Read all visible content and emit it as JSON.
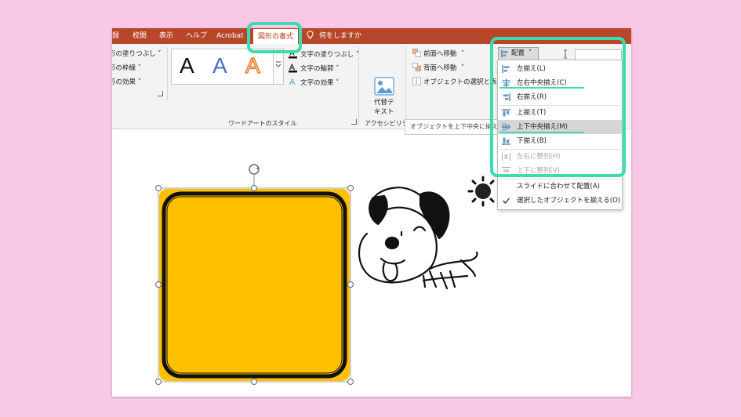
{
  "tabs": [
    {
      "label": "録"
    },
    {
      "label": "校閲"
    },
    {
      "label": "表示"
    },
    {
      "label": "ヘルプ"
    },
    {
      "label": "Acrobat"
    },
    {
      "label": "図形の書式",
      "active": true
    }
  ],
  "tell_me": "何をしますか",
  "ribbon": {
    "shape_fill": "形の塗りつぶし",
    "shape_outline": "形の枠線",
    "shape_effects": "形の効果",
    "wordart_letters": [
      "A",
      "A",
      "A"
    ],
    "text_fill": "文字の塗りつぶし",
    "text_outline": "文字の輪郭",
    "text_effects": "文字の効果",
    "wordart_group": "ワードアートのスタイル",
    "alt_text_line1": "代替テ",
    "alt_text_line2": "キスト",
    "accessibility_group": "アクセシビリティ",
    "bring_forward": "前面へ移動",
    "send_backward": "背面へ移動",
    "selection_pane": "オブジェクトの選択と表示",
    "arrange_group": "配置",
    "align_button": "配置"
  },
  "tooltip": "オブジェクトを上下中央に揃える",
  "align_menu": {
    "items": [
      {
        "label": "左揃え(L)",
        "icon": "align-left-icon",
        "enabled": true
      },
      {
        "label": "左右中央揃え(C)",
        "icon": "align-center-icon",
        "enabled": true
      },
      {
        "label": "右揃え(R)",
        "icon": "align-right-icon",
        "enabled": true
      },
      {
        "label": "上揃え(T)",
        "icon": "align-top-icon",
        "enabled": true
      },
      {
        "label": "上下中央揃え(M)",
        "icon": "align-middle-icon",
        "enabled": true,
        "hover": true
      },
      {
        "label": "下揃え(B)",
        "icon": "align-bottom-icon",
        "enabled": true
      },
      {
        "label": "左右に整列(H)",
        "icon": "distribute-horizontal-icon",
        "enabled": false
      },
      {
        "label": "上下に整列(V)",
        "icon": "distribute-vertical-icon",
        "enabled": false
      },
      {
        "label": "スライドに合わせて配置(A)",
        "icon": "",
        "enabled": true
      },
      {
        "label": "選択したオブジェクトを揃える(O)",
        "icon": "check-icon",
        "enabled": true,
        "checked": true
      }
    ]
  },
  "colors": {
    "background": "#f8c8e4",
    "ribbon_tab_bar": "#b7472a",
    "highlight": "#3ddbb0",
    "shape_fill": "#ffc000",
    "active_tab_text": "#c43e1c"
  }
}
